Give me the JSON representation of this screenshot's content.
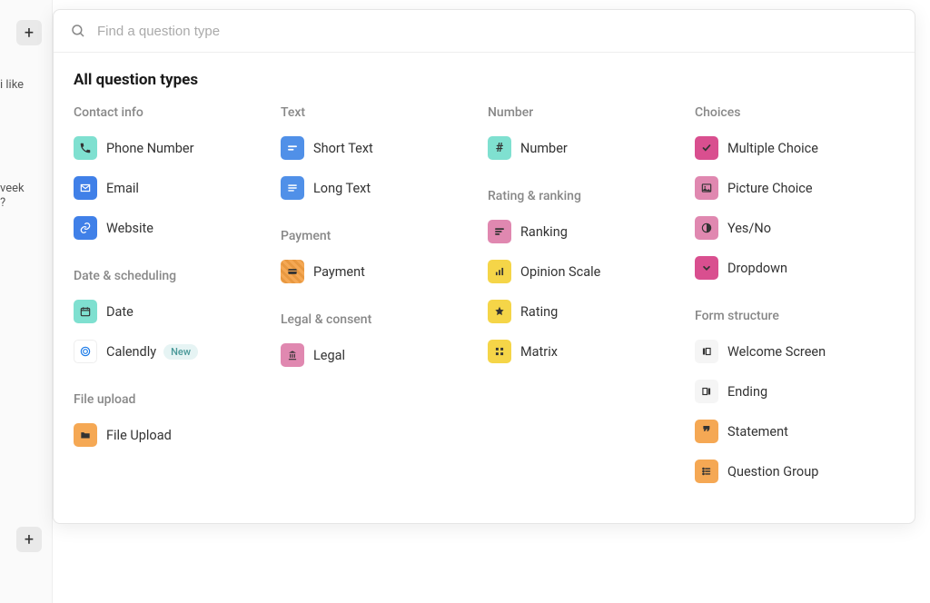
{
  "sidebar": {
    "text1": "i like",
    "text2": "veek",
    "text3": "?"
  },
  "search": {
    "placeholder": "Find a question type"
  },
  "title": "All question types",
  "categories": {
    "contact": {
      "header": "Contact info",
      "phone": "Phone Number",
      "email": "Email",
      "website": "Website"
    },
    "date": {
      "header": "Date & scheduling",
      "date": "Date",
      "calendly": "Calendly",
      "calendly_badge": "New"
    },
    "file": {
      "header": "File upload",
      "upload": "File Upload"
    },
    "text": {
      "header": "Text",
      "short": "Short Text",
      "long": "Long Text"
    },
    "payment": {
      "header": "Payment",
      "payment": "Payment"
    },
    "legal": {
      "header": "Legal & consent",
      "legal": "Legal"
    },
    "number": {
      "header": "Number",
      "number": "Number"
    },
    "rating": {
      "header": "Rating & ranking",
      "ranking": "Ranking",
      "opinion": "Opinion Scale",
      "rating": "Rating",
      "matrix": "Matrix"
    },
    "choices": {
      "header": "Choices",
      "multiple": "Multiple Choice",
      "picture": "Picture Choice",
      "yesno": "Yes/No",
      "dropdown": "Dropdown"
    },
    "structure": {
      "header": "Form structure",
      "welcome": "Welcome Screen",
      "ending": "Ending",
      "statement": "Statement",
      "group": "Question Group"
    }
  }
}
